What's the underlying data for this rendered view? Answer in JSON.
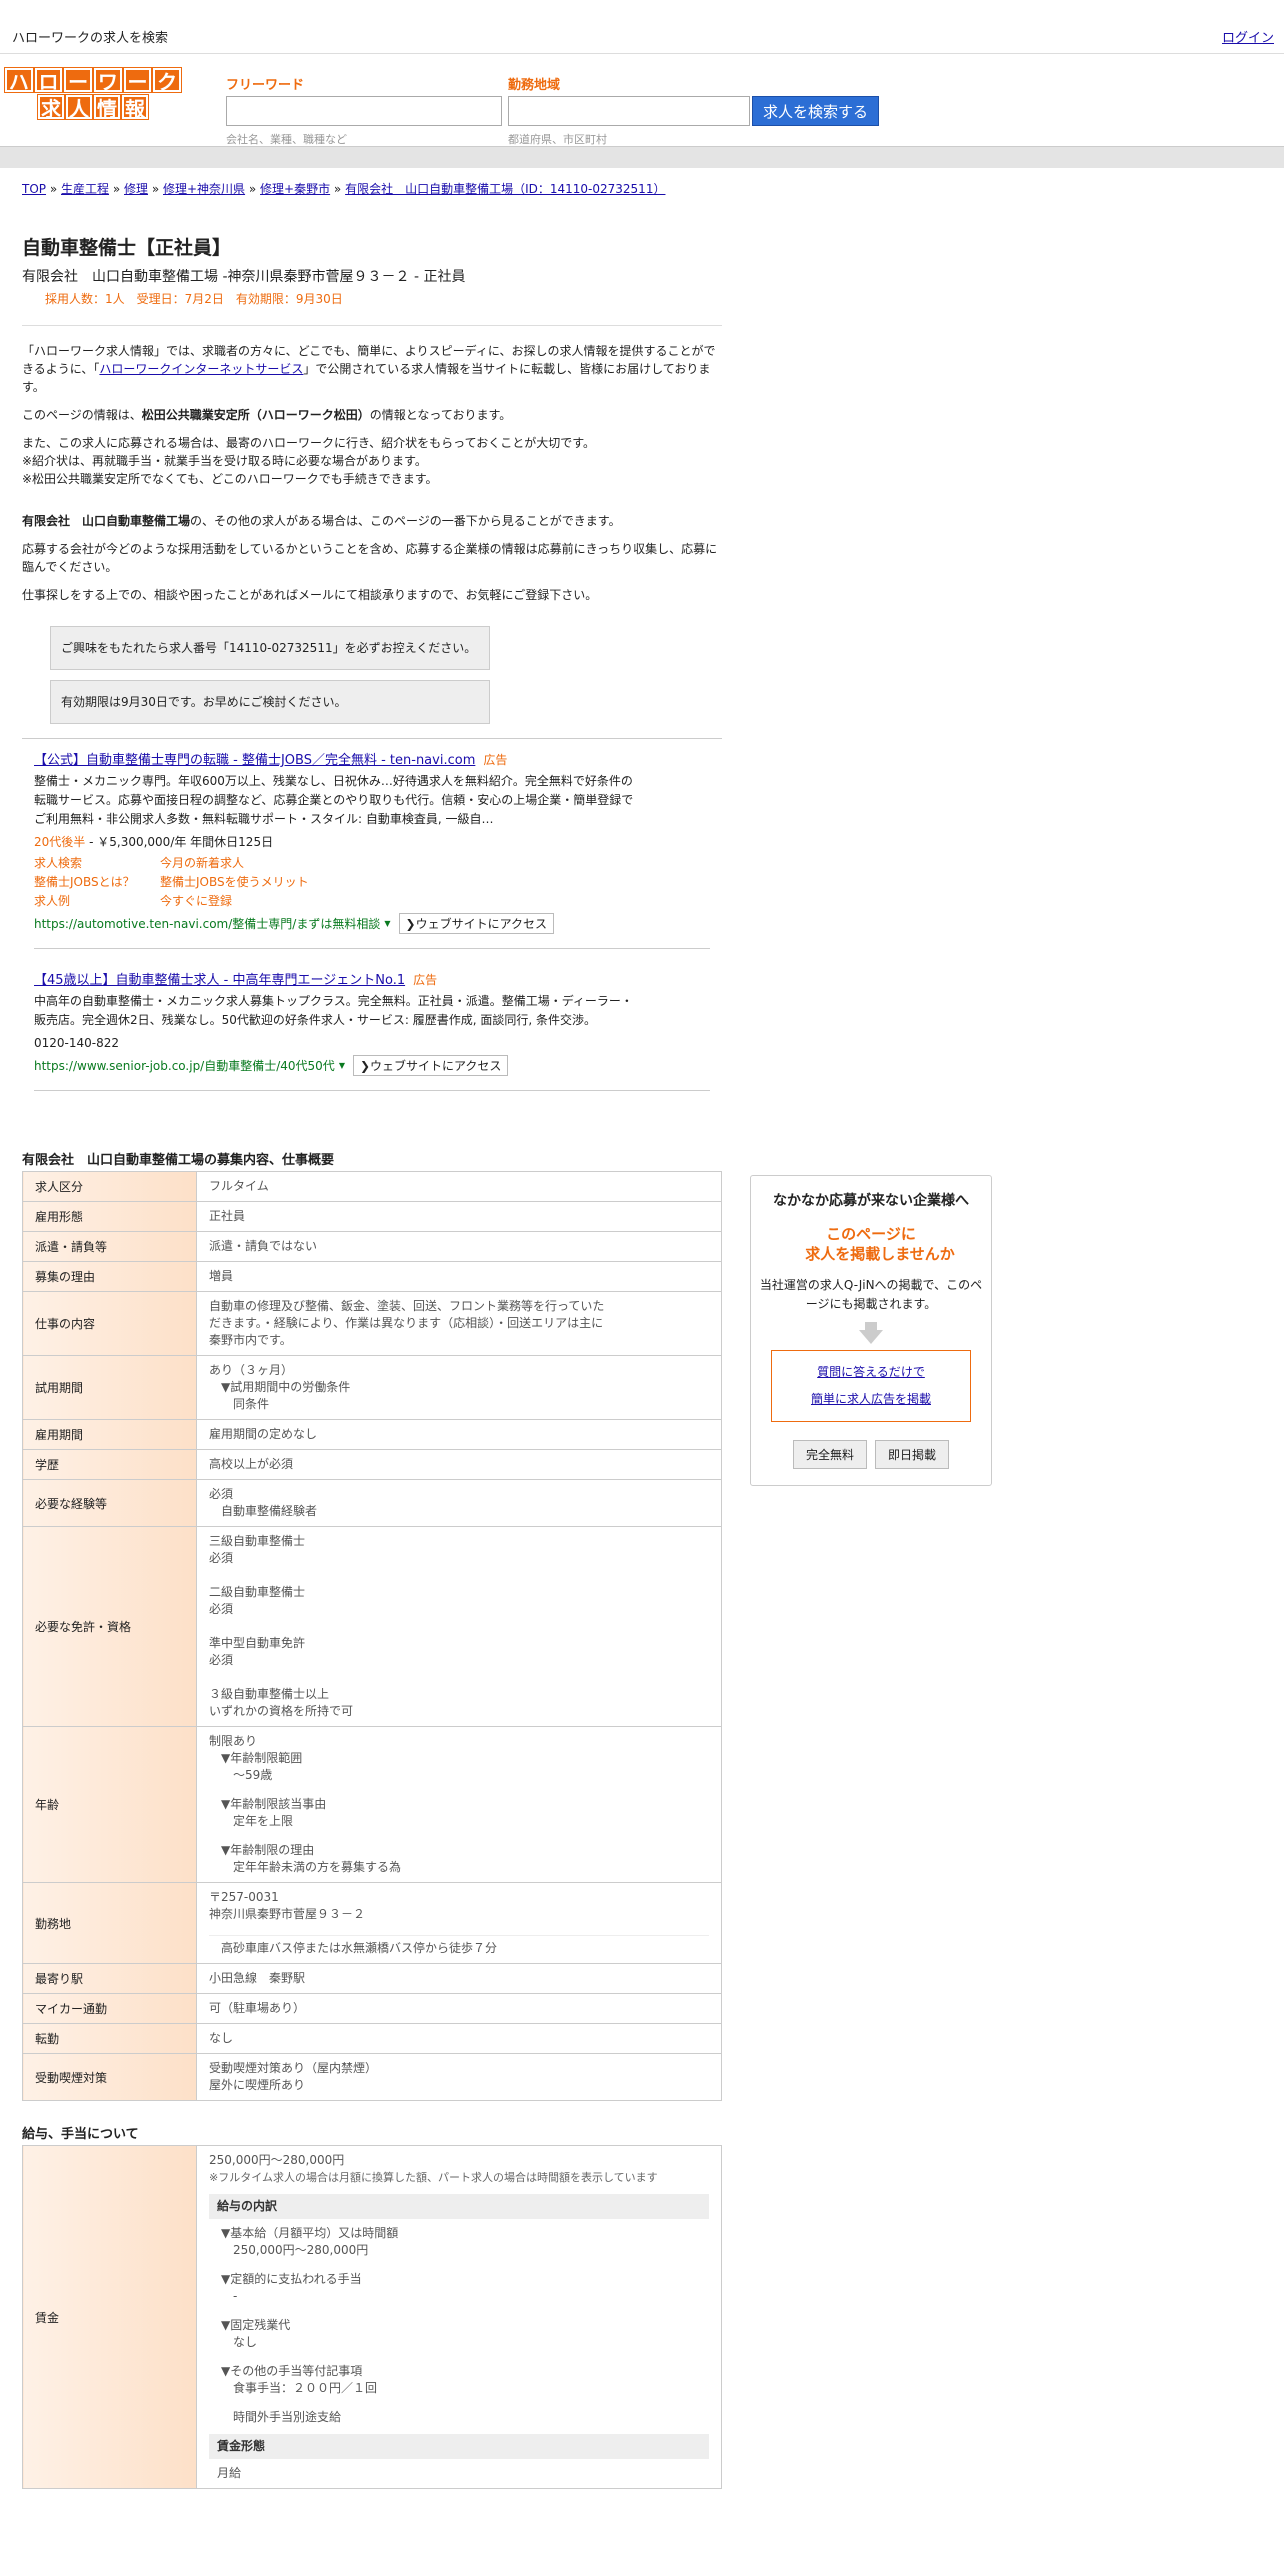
{
  "header": {
    "site_title": "ハローワークの求人を検索",
    "login": "ログイン"
  },
  "logo": {
    "row1": [
      "ハ",
      "ロ",
      "ー",
      "ワ",
      "ー",
      "ク"
    ],
    "row2": [
      "求",
      "人",
      "情",
      "報"
    ]
  },
  "search": {
    "freeword_label": "フリーワード",
    "freeword_hint": "会社名、業種、職種など",
    "area_label": "勤務地域",
    "area_hint": "都道府県、市区町村",
    "button": "求人を検索する"
  },
  "breadcrumb": [
    "TOP",
    "生産工程",
    "修理",
    "修理+神奈川県",
    "修理+秦野市",
    "有限会社　山口自動車整備工場（ID：14110-02732511）"
  ],
  "job": {
    "title": "自動車整備士【正社員】",
    "company_line": "有限会社　山口自動車整備工場 -神奈川県秦野市菅屋９３－２ - 正社員",
    "meta": "採用人数：1人　受理日：7月2日　有効期限：9月30日"
  },
  "intro": {
    "p1_a": "「ハローワーク求人情報」では、求職者の方々に、どこでも、簡単に、よりスピーディに、お探しの求人情報を提供することができるように、「",
    "p1_link": "ハローワークインターネットサービス",
    "p1_b": "」で公開されている求人情報を当サイトに転載し、皆様にお届けしております。",
    "p2_a": "このページの情報は、",
    "p2_b": "松田公共職業安定所（ハローワーク松田）",
    "p2_c": "の情報となっております。",
    "p3_1": "また、この求人に応募される場合は、最寄のハローワークに行き、紹介状をもらっておくことが大切です。",
    "p3_2": "※紹介状は、再就職手当・就業手当を受け取る時に必要な場合があります。",
    "p3_3": "※松田公共職業安定所でなくても、どこのハローワークでも手続きできます。",
    "p4_a": "有限会社　山口自動車整備工場",
    "p4_b": "の、その他の求人がある場合は、このページの一番下から見ることができます。",
    "p5": "応募する会社が今どのような採用活動をしているかということを含め、応募する企業様の情報は応募前にきっちり収集し、応募に臨んでください。",
    "p6": "仕事探しをする上での、相談や困ったことがあればメールにて相談承りますので、お気軽にご登録下さい。",
    "box1": "ご興味をもたれたら求人番号「14110-02732511」を必ずお控えください。",
    "box2": "有効期限は9月30日です。お早めにご検討ください。"
  },
  "ads": [
    {
      "title": "【公式】自動車整備士専門の転職 - 整備士JOBS／完全無料 - ten-navi.com",
      "badge": "広告",
      "desc": "整備士・メカニック専門。年収600万以上、残業なし、日祝休み…好待遇求人を無料紹介。完全無料で好条件の転職サービス。応募や面接日程の調整など、応募企業とのやり取りも代行。信頼・安心の上場企業・簡単登録でご利用無料・非公開求人多数・無料転職サポート・スタイル: 自動車検査員, 一級自…",
      "salary": "20代後半",
      "salary_b": " - ￥5,300,000/年 年間休日125日",
      "sitelinks": [
        "求人検索",
        "今月の新着求人",
        "整備士JOBSとは？",
        "整備士JOBSを使うメリット",
        "求人例",
        "今すぐに登録"
      ],
      "url": "https://automotive.ten-navi.com/整備士専門/まずは無料相談",
      "visit": "ウェブサイトにアクセス"
    },
    {
      "title": "【45歳以上】自動車整備士求人 - 中高年専門エージェントNo.1",
      "badge": "広告",
      "desc": "中高年の自動車整備士・メカニック求人募集トップクラス。完全無料。正社員・派遣。整備工場・ディーラー・販売店。完全週休2日、残業なし。50代歓迎の好条件求人・サービス: 履歴書作成, 面談同行, 条件交渉。",
      "phone": "0120-140-822",
      "url": "https://www.senior-job.co.jp/自動車整備士/40代50代",
      "visit": "ウェブサイトにアクセス"
    }
  ],
  "recruit": {
    "title": "有限会社　山口自動車整備工場の募集内容、仕事概要",
    "rows": {
      "kubun_h": "求人区分",
      "kubun": "フルタイム",
      "koyou_h": "雇用形態",
      "koyou": "正社員",
      "haken_h": "派遣・請負等",
      "haken": "派遣・請負ではない",
      "riyu_h": "募集の理由",
      "riyu": "増員",
      "shigoto_h": "仕事の内容",
      "shigoto": "自動車の修理及び整備、鈑金、塗装、回送、フロント業務等を行っていただきます。・経験により、作業は異なります（応相談）・回送エリアは主に秦野市内です。",
      "shiyou_h": "試用期間",
      "shiyou_1": "あり（３ヶ月）",
      "shiyou_2": "▼試用期間中の労働条件",
      "shiyou_3": "同条件",
      "kikan_h": "雇用期間",
      "kikan": "雇用期間の定めなし",
      "gakureki_h": "学歴",
      "gakureki": "高校以上が必須",
      "keiken_h": "必要な経験等",
      "keiken_1": "必須",
      "keiken_2": "自動車整備経験者",
      "menkyo_h": "必要な免許・資格",
      "menkyo": [
        "三級自動車整備士",
        "必須",
        "二級自動車整備士",
        "必須",
        "準中型自動車免許",
        "必須",
        "３級自動車整備士以上",
        "いずれかの資格を所持で可"
      ],
      "nenrei_h": "年齢",
      "nenrei": [
        "制限あり",
        "▼年齢制限範囲",
        "〜59歳",
        "▼年齢制限該当事由",
        "定年を上限",
        "▼年齢制限の理由",
        "定年年齢未満の方を募集する為"
      ],
      "kinmu_h": "勤務地",
      "kinmu_1": "〒257-0031",
      "kinmu_2": "神奈川県秦野市菅屋９３－２",
      "kinmu_3": "高砂車庫バス停または水無瀬橋バス停から徒歩７分",
      "eki_h": "最寄り駅",
      "eki": "小田急線　秦野駅",
      "car_h": "マイカー通勤",
      "car": "可（駐車場あり）",
      "tenkin_h": "転勤",
      "tenkin": "なし",
      "kitsuen_h": "受動喫煙対策",
      "kitsuen_1": "受動喫煙対策あり（屋内禁煙）",
      "kitsuen_2": "屋外に喫煙所あり"
    }
  },
  "salary": {
    "title": "給与、手当について",
    "row_h": "賃金",
    "range": "250,000円〜280,000円",
    "note": "※フルタイム求人の場合は月額に換算した額、パート求人の場合は時間額を表示しています",
    "breakdown_h": "給与の内訳",
    "b1": "▼基本給（月額平均）又は時間額",
    "b1v": "250,000円〜280,000円",
    "b2": "▼定額的に支払われる手当",
    "b2v": "-",
    "b3": "▼固定残業代",
    "b3v": "なし",
    "b4": "▼その他の手当等付記事項",
    "b4v": "食事手当：２００円／１回",
    "b4v2": "時間外手当別途支給",
    "form_h": "賃金形態",
    "form": "月給"
  },
  "sidebar": {
    "heading": "なかなか応募が来ない企業様へ",
    "orange_1": "このページに",
    "orange_2": "求人を掲載しませんか",
    "desc": "当社運営の求人Q-JiNへの掲載で、このページにも掲載されます。",
    "link1": "質問に答えるだけで",
    "link2": "簡単に求人広告を掲載",
    "btn1": "完全無料",
    "btn2": "即日掲載"
  }
}
